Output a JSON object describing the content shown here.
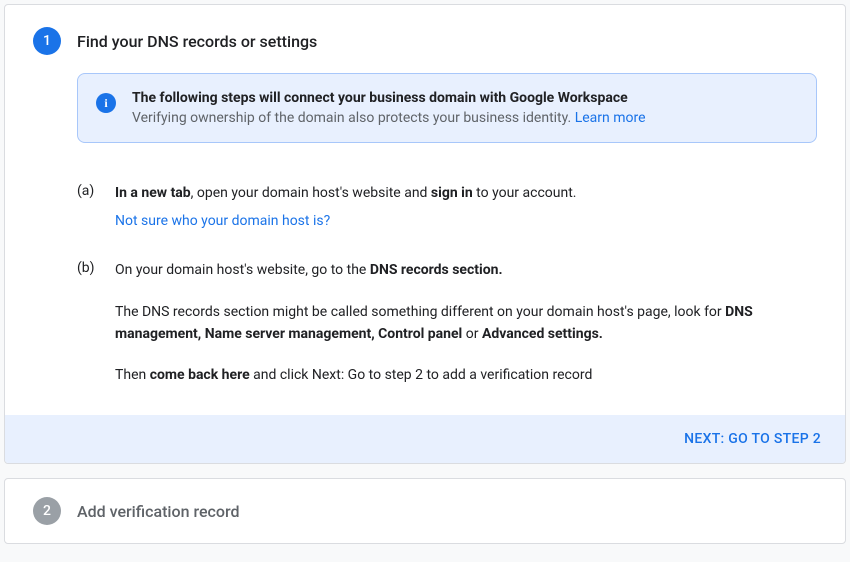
{
  "step1": {
    "number": "1",
    "title": "Find your DNS records or settings",
    "info": {
      "title": "The following steps will connect your business domain with Google Workspace",
      "text": "Verifying ownership of the domain also protects your business identity. ",
      "link": "Learn more"
    },
    "items": {
      "a": {
        "label": "(a)",
        "part1_bold": "In a new tab",
        "part1_rest": ", open your domain host's website and ",
        "part1_bold2": "sign in",
        "part1_end": " to your account.",
        "link": "Not sure who your domain host is?"
      },
      "b": {
        "label": "(b)",
        "line1_start": "On your domain host's website, go to the ",
        "line1_bold": "DNS records section.",
        "line2_start": "The DNS records section might be called something different on your domain host's page, look for ",
        "line2_bold": "DNS management, Name server management, Control panel",
        "line2_mid": " or ",
        "line2_bold2": "Advanced settings.",
        "line3_start": "Then ",
        "line3_bold": "come back here",
        "line3_end": " and click Next: Go to step 2 to add a verification record"
      }
    },
    "next_button": "NEXT: GO TO STEP 2"
  },
  "step2": {
    "number": "2",
    "title": "Add verification record"
  }
}
